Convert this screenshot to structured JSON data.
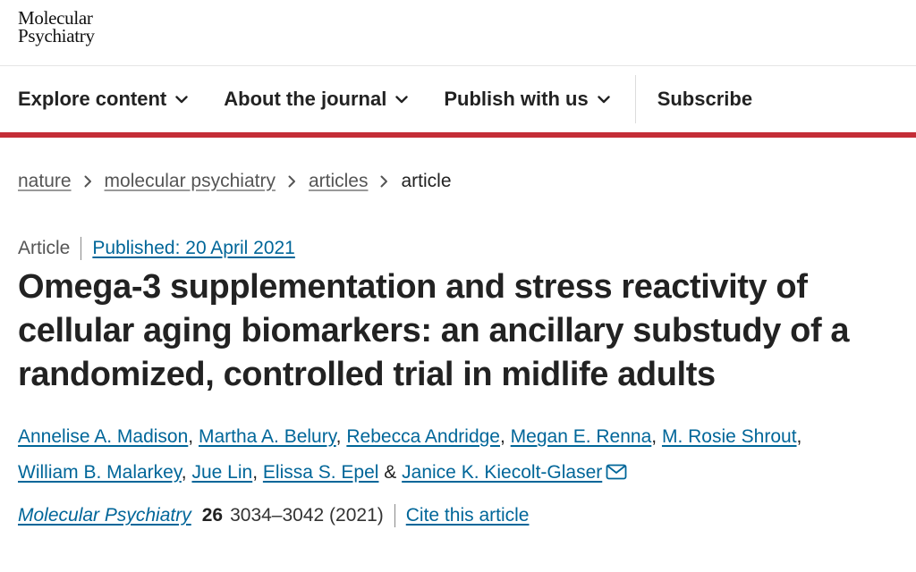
{
  "brand": {
    "logo_line1": "Molecular",
    "logo_line2": "Psychiatry"
  },
  "nav": {
    "items": [
      {
        "label": "Explore content",
        "icon": "chevron-down-icon"
      },
      {
        "label": "About the journal",
        "icon": "chevron-down-icon"
      },
      {
        "label": "Publish with us",
        "icon": "chevron-down-icon"
      }
    ],
    "subscribe_label": "Subscribe",
    "accent_color": "#c42d37"
  },
  "breadcrumb": {
    "items": [
      "nature",
      "molecular psychiatry",
      "articles"
    ],
    "current": "article",
    "separator_icon": "chevron-right-icon"
  },
  "article": {
    "type": "Article",
    "published": "Published: 20 April 2021",
    "title": "Omega-3 supplementation and stress reactivity of cellular aging biomarkers: an ancillary substudy of a randomized, controlled trial in midlife adults",
    "authors": [
      "Annelise A. Madison",
      "Martha A. Belury",
      "Rebecca Andridge",
      "Megan E. Renna",
      "M. Rosie Shrout",
      "William B. Malarkey",
      "Jue Lin",
      "Elissa S. Epel",
      "Janice K. Kiecolt-Glaser"
    ],
    "author_separator": ",",
    "author_conjunction": "&",
    "corresponding_icon": "mail-icon",
    "link_color": "#006699"
  },
  "citation": {
    "journal": "Molecular Psychiatry",
    "volume": "26",
    "pages_year": "3034–3042 (2021)",
    "cite_label": "Cite this article"
  }
}
